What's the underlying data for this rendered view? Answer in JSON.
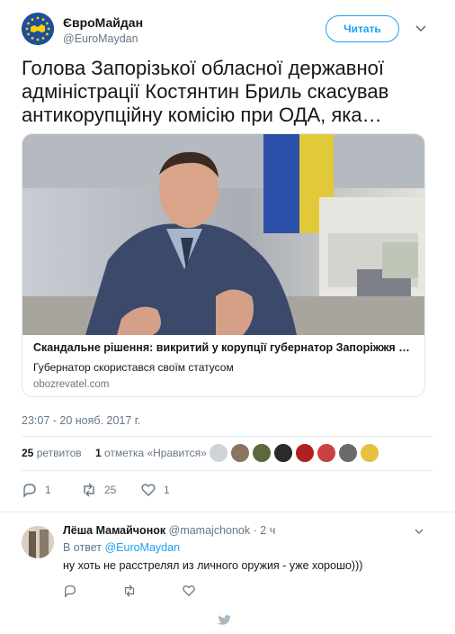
{
  "account": {
    "name": "ЄвроМайдан",
    "handle": "@EuroMaydan",
    "follow_label": "Читать"
  },
  "tweet": {
    "text": "Голова Запорізької обласної державної адміністрації Костянтин Бриль скасував антикорупційну комісію при ОДА, яка…",
    "card": {
      "title": "Скандальне рішення: викритий у корупції губернатор Запоріжжя раптов…",
      "description": "Губернатор скористався своїм статусом",
      "domain": "obozrevatel.com"
    },
    "timestamp": "23:07 - 20 нояб. 2017 г.",
    "stats": {
      "retweets_count": "25",
      "retweets_label": "ретвитов",
      "likes_count": "1",
      "likes_label": "отметка «Нравится»"
    },
    "actions": {
      "replies": "1",
      "retweets": "25",
      "likes": "1"
    }
  },
  "reply": {
    "name": "Лёша Мамайчонок",
    "handle": "@mamajchonok",
    "separator": "·",
    "time": "2 ч",
    "in_reply_prefix": "В ответ",
    "in_reply_handle": "@EuroMaydan",
    "text": "ну хоть не расстрелял из личного оружия - уже хорошо)))"
  },
  "colors": {
    "accent": "#1da1f2",
    "muted": "#657786",
    "text": "#14171a",
    "border": "#e1e8ed"
  },
  "icons": [
    "caret-down-icon",
    "reply-icon",
    "retweet-icon",
    "like-icon",
    "twitter-bird-icon"
  ]
}
